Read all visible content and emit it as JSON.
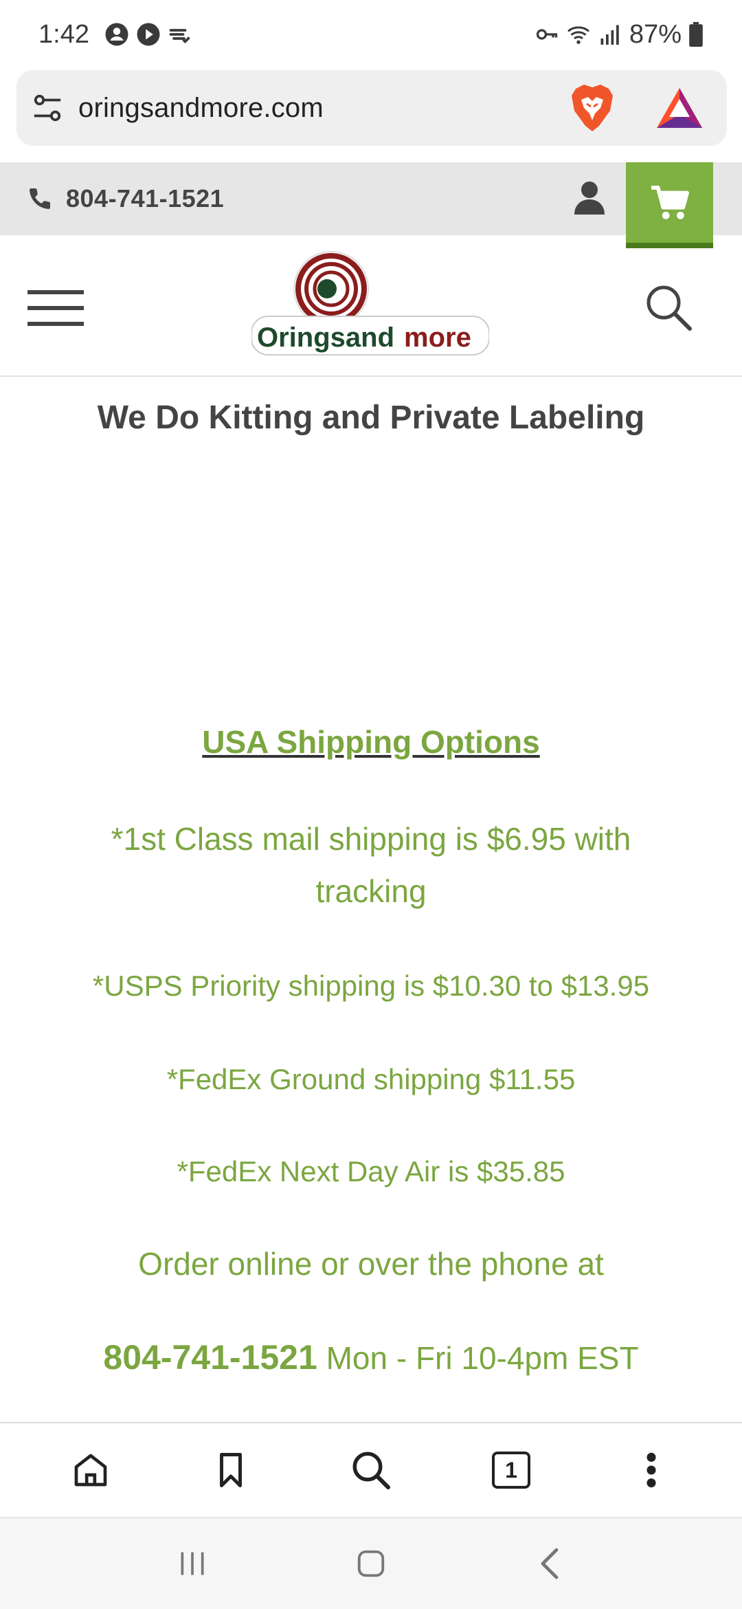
{
  "status_bar": {
    "time": "1:42",
    "battery": "87%",
    "icons": [
      "account-circle-icon",
      "play-icon",
      "cloud-sync-icon",
      "vpn-key-icon",
      "wifi-icon",
      "signal-icon",
      "battery-icon"
    ]
  },
  "browser": {
    "url": "oringsandmore.com",
    "tab_count": "1"
  },
  "site": {
    "phone": "804-741-1521",
    "heading": "We Do Kitting and Private Labeling",
    "logo_text": "Oringsandmore",
    "accent_color": "#7eb042",
    "shipping": {
      "title": "USA Shipping Options",
      "line1": "*1st Class mail shipping is $6.95 with tracking",
      "line2": "*USPS Priority shipping is $10.30 to $13.95",
      "line3": "*FedEx Ground shipping $11.55",
      "line4": "*FedEx Next Day Air is $35.85",
      "order_line": "Order online or over the phone at",
      "order_phone": "804-741-1521",
      "hours": " Mon - Fri 10-4pm EST"
    }
  }
}
